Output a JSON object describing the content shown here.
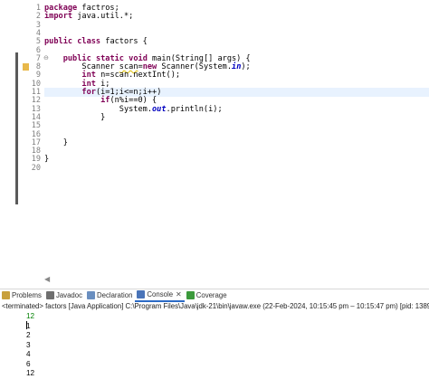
{
  "editor": {
    "lines": [
      {
        "n": "1",
        "tokens": [
          {
            "t": "package",
            "c": "kw"
          },
          {
            "t": " factros;"
          }
        ]
      },
      {
        "n": "2",
        "tokens": [
          {
            "t": "import",
            "c": "kw"
          },
          {
            "t": " java.util.*;"
          }
        ]
      },
      {
        "n": "3",
        "tokens": []
      },
      {
        "n": "4",
        "tokens": []
      },
      {
        "n": "5",
        "tokens": [
          {
            "t": "public",
            "c": "kw"
          },
          {
            "t": " "
          },
          {
            "t": "class",
            "c": "kw"
          },
          {
            "t": " factors {"
          }
        ]
      },
      {
        "n": "6",
        "tokens": []
      },
      {
        "n": "7",
        "fold": "⊖",
        "tokens": [
          {
            "t": "    "
          },
          {
            "t": "public",
            "c": "kw"
          },
          {
            "t": " "
          },
          {
            "t": "static",
            "c": "kw"
          },
          {
            "t": " "
          },
          {
            "t": "void",
            "c": "kw"
          },
          {
            "t": " main(String[] args) {"
          }
        ]
      },
      {
        "n": "8",
        "tokens": [
          {
            "t": "        Scanner "
          },
          {
            "t": "scan",
            "c": "ul"
          },
          {
            "t": "="
          },
          {
            "t": "new",
            "c": "kw"
          },
          {
            "t": " Scanner(System."
          },
          {
            "t": "in",
            "c": "fld"
          },
          {
            "t": ");"
          }
        ]
      },
      {
        "n": "9",
        "tokens": [
          {
            "t": "        "
          },
          {
            "t": "int",
            "c": "kw"
          },
          {
            "t": " n=scan.nextInt();"
          }
        ]
      },
      {
        "n": "10",
        "tokens": [
          {
            "t": "        "
          },
          {
            "t": "int",
            "c": "kw"
          },
          {
            "t": " i;"
          }
        ]
      },
      {
        "n": "11",
        "current": true,
        "tokens": [
          {
            "t": "        "
          },
          {
            "t": "for",
            "c": "kw"
          },
          {
            "t": "(i=1;i<=n;i++)"
          }
        ]
      },
      {
        "n": "12",
        "tokens": [
          {
            "t": "            "
          },
          {
            "t": "if",
            "c": "kw"
          },
          {
            "t": "(n%i==0) {"
          }
        ]
      },
      {
        "n": "13",
        "tokens": [
          {
            "t": "                System."
          },
          {
            "t": "out",
            "c": "fld"
          },
          {
            "t": ".println(i);"
          }
        ]
      },
      {
        "n": "14",
        "tokens": [
          {
            "t": "            }"
          }
        ]
      },
      {
        "n": "15",
        "tokens": []
      },
      {
        "n": "16",
        "tokens": []
      },
      {
        "n": "17",
        "tokens": [
          {
            "t": "    }"
          }
        ]
      },
      {
        "n": "18",
        "tokens": []
      },
      {
        "n": "19",
        "tokens": [
          {
            "t": "}"
          }
        ]
      },
      {
        "n": "20",
        "tokens": []
      }
    ]
  },
  "views": {
    "tabs": [
      {
        "id": "problems",
        "label": "Problems",
        "icon": "problems-icon",
        "color": "#c8a03c"
      },
      {
        "id": "javadoc",
        "label": "Javadoc",
        "icon": "at-icon",
        "color": "#6f6f6f"
      },
      {
        "id": "declaration",
        "label": "Declaration",
        "icon": "declaration-icon",
        "color": "#6a8fc0"
      },
      {
        "id": "console",
        "label": "Console",
        "icon": "console-icon",
        "color": "#4a74b8",
        "active": true,
        "closable": "✕"
      },
      {
        "id": "coverage",
        "label": "Coverage",
        "icon": "coverage-icon",
        "color": "#3c9a3c"
      }
    ]
  },
  "console": {
    "status": "<terminated> factors [Java Application] C:\\Program Files\\Java\\jdk-21\\bin\\javaw.exe  (22-Feb-2024, 10:15:45 pm – 10:15:47 pm) [pid: 13896]",
    "input": "12",
    "output": [
      "1",
      "2",
      "3",
      "4",
      "6",
      "12"
    ]
  },
  "colors": {
    "keyword": "#7f0055",
    "field": "#0000c0",
    "current_line": "#e8f2fe",
    "console_input": "#008000"
  }
}
